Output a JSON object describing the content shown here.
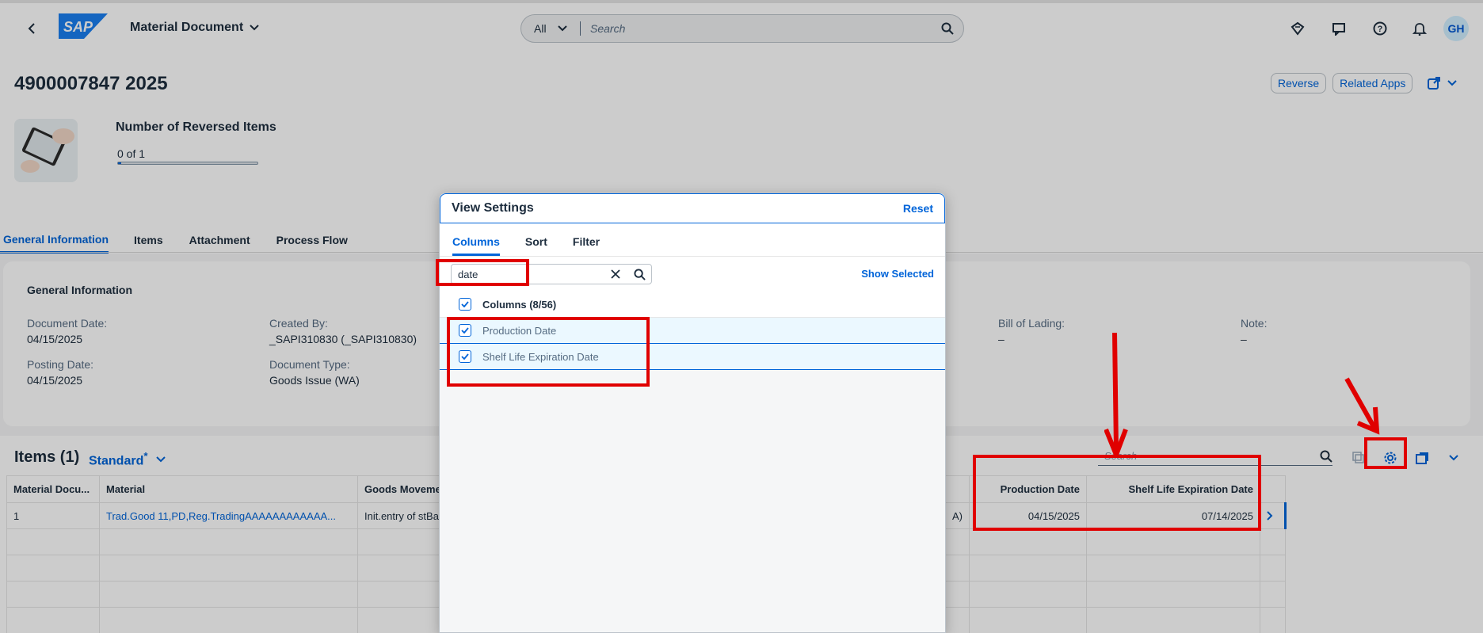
{
  "shell": {
    "app_title": "Material Document",
    "search_scope": "All",
    "search_placeholder": "Search",
    "avatar_initials": "GH"
  },
  "header": {
    "title": "4900007847 2025",
    "buttons": {
      "reverse": "Reverse",
      "related_apps": "Related Apps"
    },
    "kpi": {
      "title": "Number of Reversed Items",
      "value": "0 of 1",
      "progress": 0
    }
  },
  "tabs": [
    "General Information",
    "Items",
    "Attachment",
    "Process Flow"
  ],
  "general_info": {
    "title": "General Information",
    "fields": [
      {
        "label": "Document Date:",
        "value": "04/15/2025"
      },
      {
        "label": "Posting Date:",
        "value": "04/15/2025"
      },
      {
        "label": "Created By:",
        "value": "_SAPI310830 (_SAPI310830)"
      },
      {
        "label": "Document Type:",
        "value": "Goods Issue (WA)"
      },
      {
        "label": "Bill of Lading:",
        "value": "–"
      },
      {
        "label": "Note:",
        "value": "–"
      }
    ]
  },
  "items": {
    "title": "Items (1)",
    "variant": "Standard",
    "variant_modified": "*",
    "search_placeholder": "Search",
    "columns": [
      "Material Docu...",
      "Material",
      "Goods Moveme",
      "Production Date",
      "Shelf Life Expiration Date"
    ],
    "rows": [
      {
        "doc": "1",
        "material": "Trad.Good 11,PD,Reg.TradingAAAAAAAAAAAA...",
        "movement": "Init.entry of stBa",
        "hidden_tail": "A)",
        "production_date": "04/15/2025",
        "shelf_life": "07/14/2025"
      }
    ]
  },
  "dialog": {
    "title": "View Settings",
    "reset": "Reset",
    "tabs": [
      "Columns",
      "Sort",
      "Filter"
    ],
    "search_value": "date",
    "show_selected": "Show Selected",
    "columns_header": "Columns (8/56)",
    "options": [
      "Production Date",
      "Shelf Life Expiration Date"
    ]
  },
  "colors": {
    "accent": "#0064d9",
    "annotation_red": "#e00000"
  }
}
